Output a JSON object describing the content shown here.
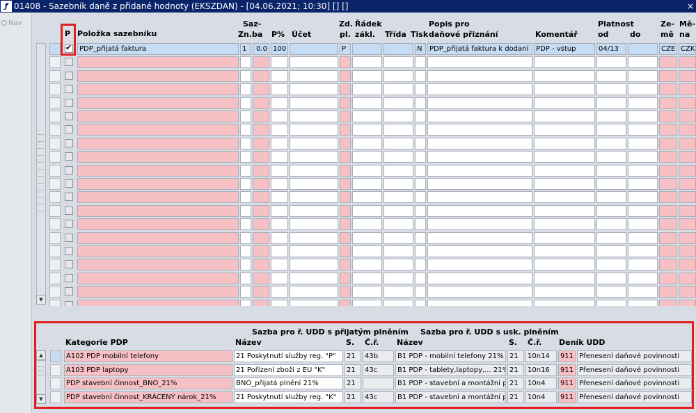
{
  "window": {
    "title": "01408 - Sazebník daně z přidané hodnoty (EKSZDAN) - [04.06.2021; 10:30] [] []",
    "close": "×"
  },
  "nav": {
    "label": "Nav"
  },
  "grid": {
    "headers": {
      "p": "P",
      "polozka": "Položka sazebníku",
      "saz1": "Saz-",
      "saz2": "ba",
      "zn": "Zn.",
      "pp": "P%",
      "ucet": "Účet",
      "zd1": "Zd.",
      "zd2": "pl.",
      "rad1": "Řádek",
      "rad2": "zákl.",
      "trida": "Třída",
      "tisk": "Tisk",
      "popis1": "Popis pro",
      "popis2": "daňové přiznání",
      "komentar": "Komentář",
      "plat1": "Platnost",
      "plat_od": "od",
      "plat_do": "do",
      "zeme1": "Ze-",
      "zeme2": "mě",
      "mena1": "Mě-",
      "mena2": "na"
    },
    "row1": {
      "checked": "✔",
      "polozka": "PDP_přijatá faktura",
      "zn": "1",
      "sazba": "0.0",
      "pp": "100",
      "ucet": "",
      "zd": "P",
      "radek": "",
      "trida": "",
      "tisk": "N",
      "popis": "PDP_přijatá faktura k dodaní",
      "komentar": "PDP - vstup",
      "od": "04/13",
      "do": "",
      "zeme": "CZE",
      "mena": "CZK"
    }
  },
  "pdp": {
    "headers": {
      "kategorie": "Kategorie PDP",
      "group1": "Sazba pro ř. UDD s přijatým plněním",
      "nazev1": "Název",
      "s1": "S.",
      "cr1": "Č.ř.",
      "group2": "Sazba pro ř. UDD s usk. plněním",
      "nazev2": "Název",
      "s2": "S.",
      "cr2": "Č.ř.",
      "denik": "Deník UDD"
    },
    "rows": [
      {
        "kat": "A102 PDP mobilní telefony",
        "n1": "21  Poskytnutí služby reg. \"P\"",
        "s1": "21",
        "c1": "43b",
        "n2": "B1  PDP - mobilní telefony 21%",
        "s2": "21",
        "c2": "10n14",
        "d": "911",
        "dn": "Přenesení daňové povinnosti"
      },
      {
        "kat": "A103 PDP laptopy",
        "n1": "21  Pořízení zboží z EU \"K\"",
        "s1": "21",
        "c1": "43c",
        "n2": "B1  PDP - tablety,laptopy,... 21%",
        "s2": "21",
        "c2": "10n16",
        "d": "911",
        "dn": "Přenesení daňové povinnosti"
      },
      {
        "kat": "PDP stavební činnost_BNO_21%",
        "n1": "BNO_přijatá plnění 21%",
        "s1": "21",
        "c1": "",
        "n2": "B1  PDP - stavební a montážní p",
        "s2": "21",
        "c2": "10n4",
        "d": "911",
        "dn": "Přenesení daňové povinnosti"
      },
      {
        "kat": "PDP stavební činnost_KRÁCENÝ nárok_21%",
        "n1": "21  Poskytnutí služby reg. \"K\"",
        "s1": "21",
        "c1": "43c",
        "n2": "B1  PDP - stavební a montážní p",
        "s2": "21",
        "c2": "10n4",
        "d": "911",
        "dn": "Přenesení daňové povinnosti"
      }
    ]
  }
}
